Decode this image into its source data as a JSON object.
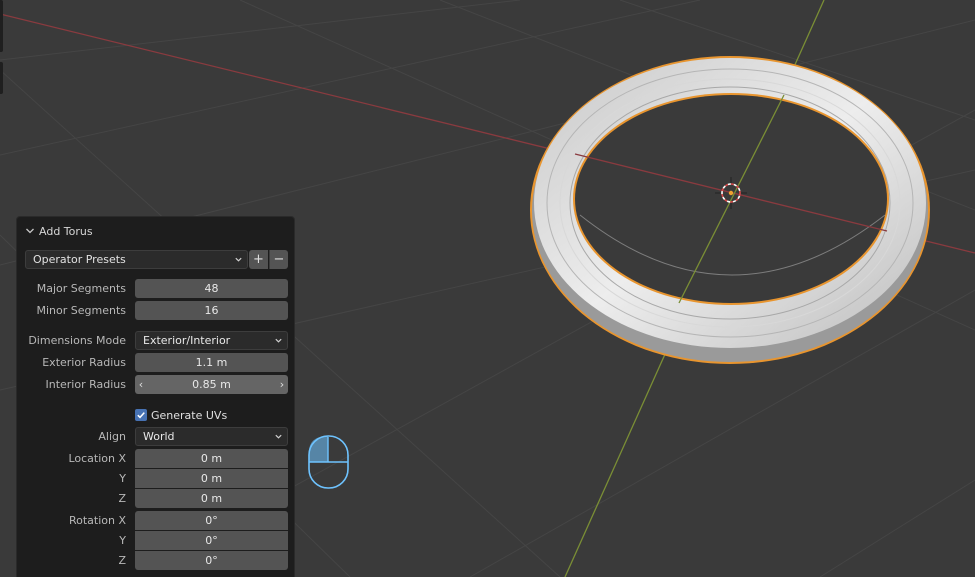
{
  "operator": {
    "title": "Add Torus",
    "presets_label": "Operator Presets",
    "add_preset_symbol": "+",
    "remove_preset_symbol": "−"
  },
  "segments": {
    "major_label": "Major Segments",
    "major_value": "48",
    "minor_label": "Minor Segments",
    "minor_value": "16"
  },
  "dimensions": {
    "mode_label": "Dimensions Mode",
    "mode_value": "Exterior/Interior",
    "exterior_label": "Exterior Radius",
    "exterior_value": "1.1 m",
    "interior_label": "Interior Radius",
    "interior_value": "0.85 m"
  },
  "uv": {
    "label": "Generate UVs",
    "checked": true
  },
  "align": {
    "label": "Align",
    "value": "World"
  },
  "location": {
    "x_label": "Location X",
    "x_value": "0 m",
    "y_label": "Y",
    "y_value": "0 m",
    "z_label": "Z",
    "z_value": "0 m"
  },
  "rotation": {
    "x_label": "Rotation X",
    "x_value": "0°",
    "y_label": "Y",
    "y_value": "0°",
    "z_label": "Z",
    "z_value": "0°"
  },
  "colors": {
    "background": "#3a3a3a",
    "grid": "#454545",
    "x_axis": "#8a3a3f",
    "y_axis": "#7a8e35",
    "selection_outline": "#e8952f",
    "checkbox": "#4772b3",
    "mouse_hint": "#6ec3ff"
  },
  "icons": {
    "collapse": "chevron-down-icon",
    "dropdown": "chevron-down-icon",
    "decrement": "chevron-left-icon",
    "increment": "chevron-right-icon",
    "checkbox": "check-icon",
    "mouse": "mouse-left-click-icon",
    "origin": "object-origin-icon",
    "cursor": "3d-cursor-icon"
  }
}
